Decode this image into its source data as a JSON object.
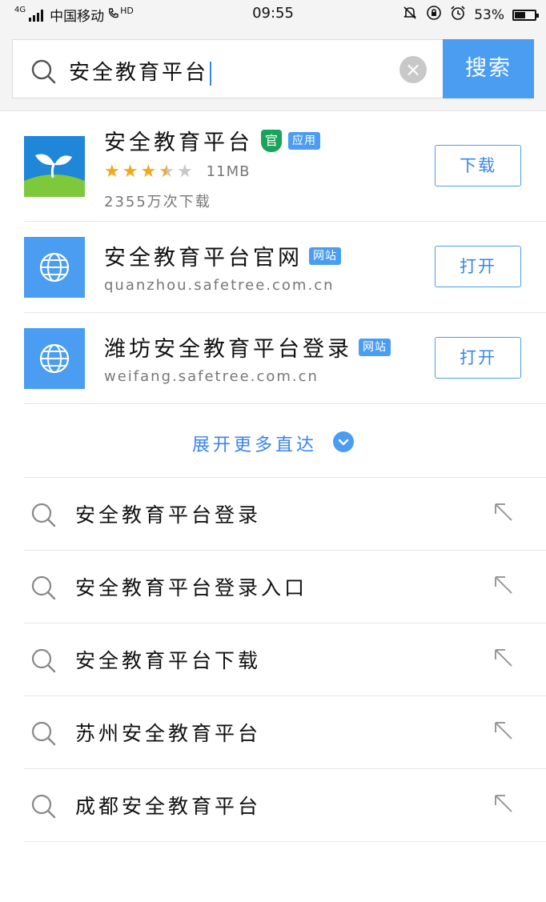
{
  "status_bar": {
    "network": "4G",
    "carrier": "中国移动",
    "hd": "HD",
    "time": "09:55",
    "battery": "53%",
    "battery_level": 0.53
  },
  "search": {
    "query": "安全教育平台",
    "button_label": "搜索"
  },
  "results": [
    {
      "type": "app",
      "title": "安全教育平台",
      "official_badge": "官",
      "tag": "应用",
      "rating": 3.5,
      "size": "11MB",
      "downloads": "2355万次下载",
      "action": "下载"
    },
    {
      "type": "website",
      "title": "安全教育平台官网",
      "tag": "网站",
      "url": "quanzhou.safetree.com.cn",
      "action": "打开"
    },
    {
      "type": "website",
      "title": "潍坊安全教育平台登录",
      "tag": "网站",
      "url": "weifang.safetree.com.cn",
      "action": "打开"
    }
  ],
  "expand_label": "展开更多直达",
  "suggestions": [
    "安全教育平台登录",
    "安全教育平台登录入口",
    "安全教育平台下载",
    "苏州安全教育平台",
    "成都安全教育平台"
  ],
  "colors": {
    "accent": "#4a9df0",
    "official_green": "#1aa35a",
    "star": "#f3a81b"
  }
}
